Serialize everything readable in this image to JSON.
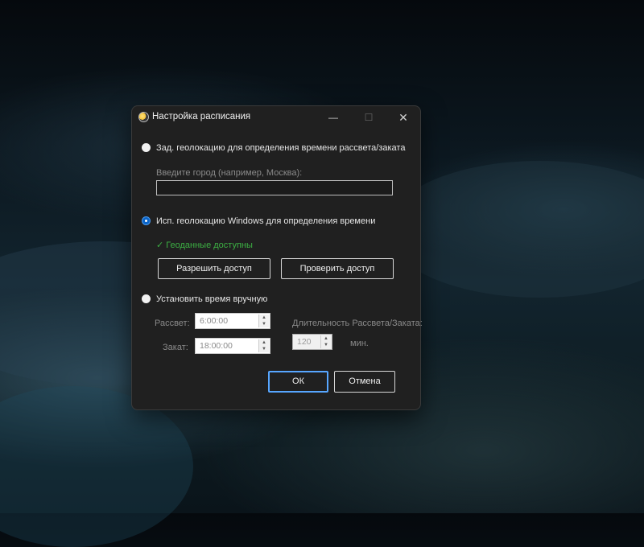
{
  "window": {
    "title": "Настройка расписания",
    "minimize": "—",
    "maximize": "☐",
    "close": "✕"
  },
  "options": {
    "geo_manual_label": "Зад. геолокацию для определения времени рассвета/заката",
    "city_placeholder": "Введите город (например, Москва):",
    "city_value": "",
    "windows_geo_label": "Исп. геолокацию Windows для определения времени",
    "geo_status": "✓ Геоданные доступны",
    "allow_access": "Разрешить доступ",
    "check_access": "Проверить доступ",
    "manual_time_label": "Установить время вручную"
  },
  "manual": {
    "sunrise_label": "Рассвет:",
    "sunrise_value": "6:00:00",
    "sunset_label": "Закат:",
    "sunset_value": "18:00:00",
    "duration_label": "Длительность Рассвета/Заката:",
    "duration_value": "120",
    "duration_unit": "мин."
  },
  "footer": {
    "ok": "ОК",
    "cancel": "Отмена"
  },
  "colors": {
    "accent": "#0a64c8",
    "status_ok": "#3cb043"
  }
}
